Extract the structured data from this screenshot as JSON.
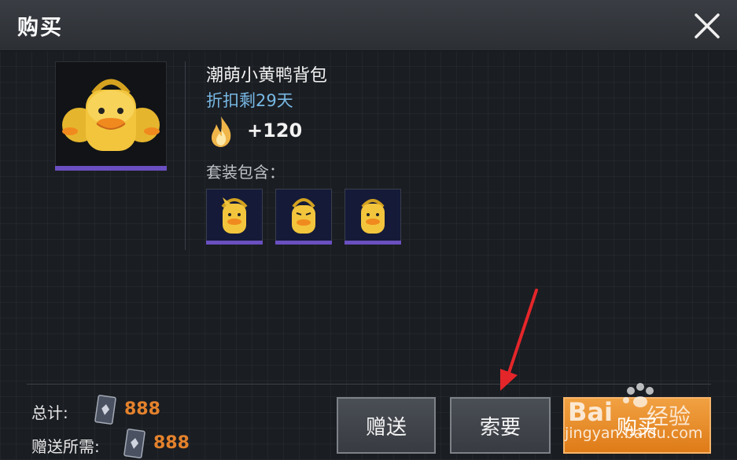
{
  "dialog": {
    "title": "购买"
  },
  "item": {
    "name": "潮萌小黄鸭背包",
    "discount_text": "折扣剩29天",
    "points": "+120",
    "includes_label": "套装包含：",
    "sub_items": [
      {
        "icon": "duck-backpack-icon"
      },
      {
        "icon": "duck-backpack-icon"
      },
      {
        "icon": "duck-backpack-icon"
      }
    ]
  },
  "summary": {
    "total_label": "总计:",
    "total_value": "888",
    "gift_required_label": "赠送所需:",
    "gift_required_value": "888",
    "currency_icon": "coupon-icon"
  },
  "buttons": {
    "gift": "赠送",
    "request": "索要",
    "buy": "购买"
  },
  "watermark": {
    "brand": "Bai",
    "brand_suffix": "经验",
    "url": "jingyan.baidu.com"
  },
  "colors": {
    "accent_purple": "#6a4fc0",
    "discount_blue": "#78b8e4",
    "price_orange": "#e4822c",
    "buy_button": "#e88a2a"
  }
}
